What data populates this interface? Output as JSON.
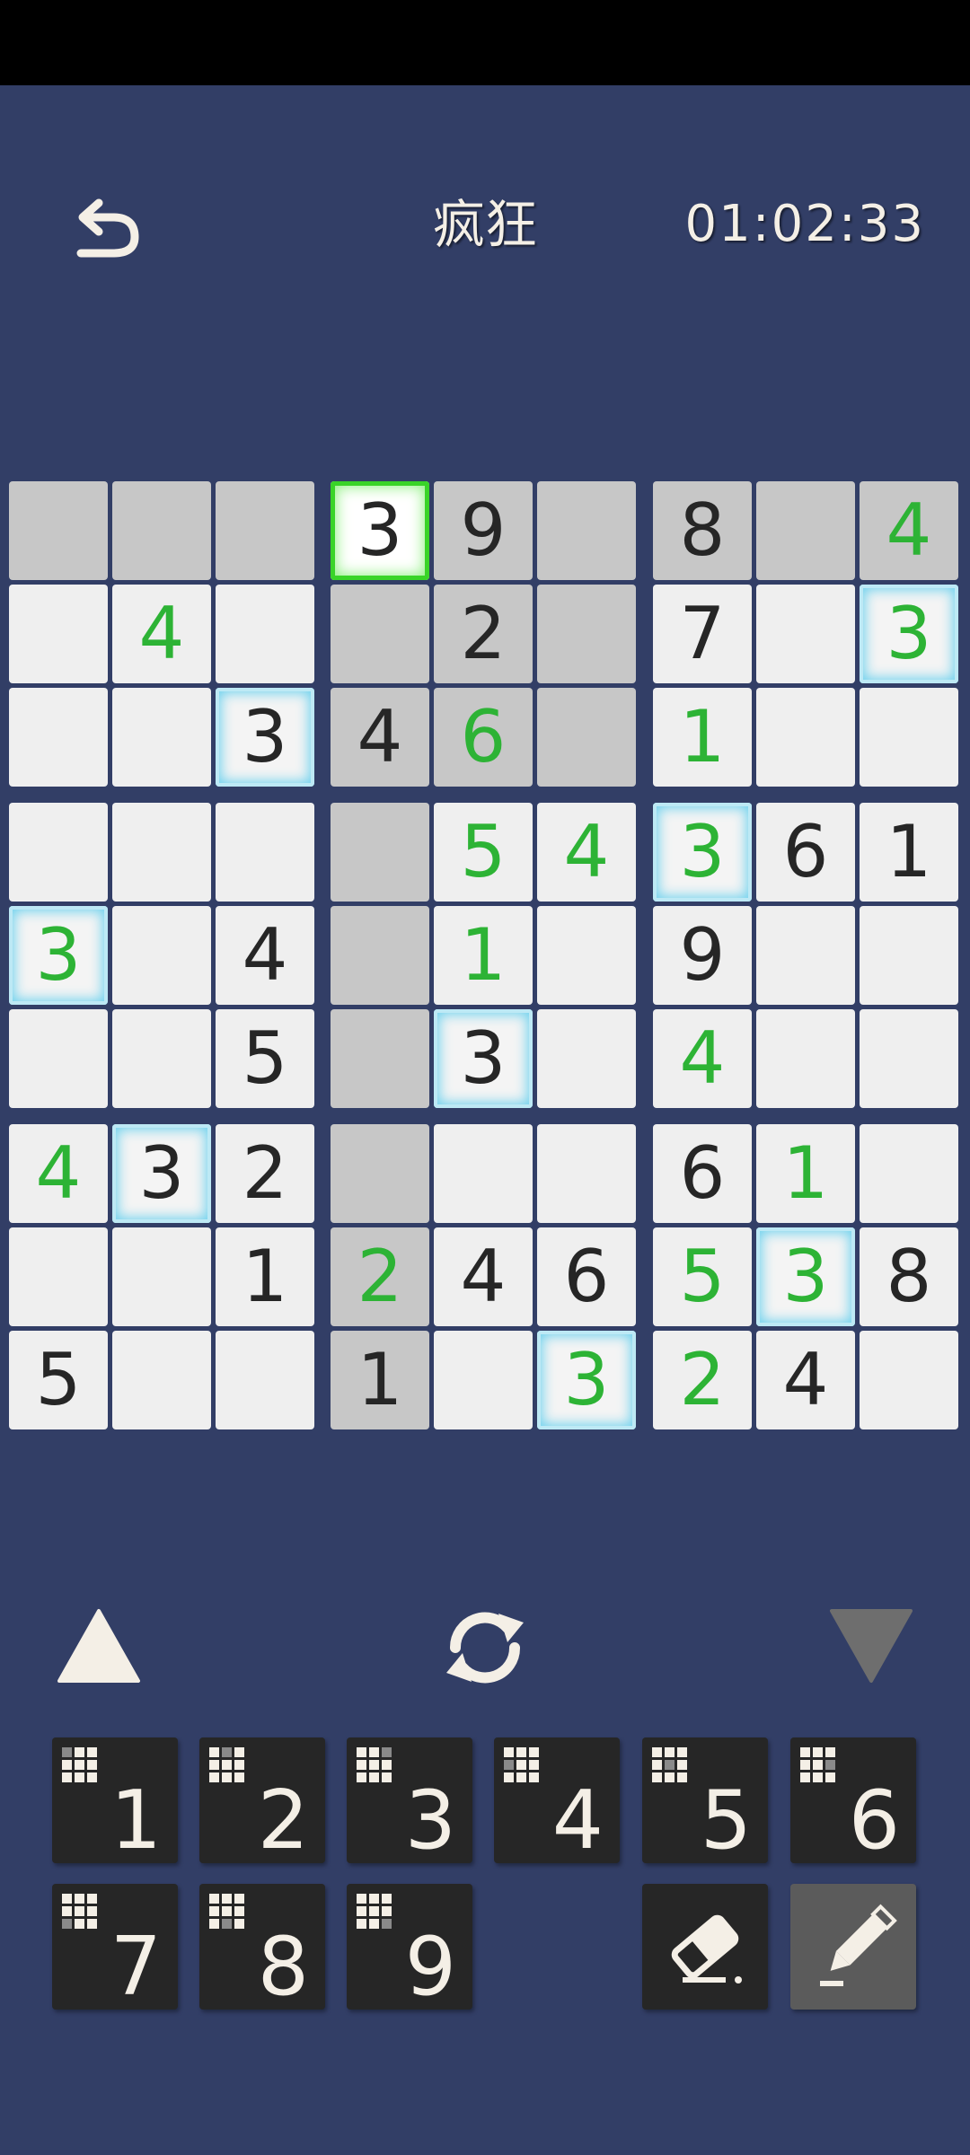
{
  "header": {
    "title": "疯狂",
    "timer": "01:02:33",
    "back_icon": "back-arrow-icon"
  },
  "board": {
    "rows": [
      [
        "",
        "",
        "",
        "3",
        "9",
        "",
        "8",
        "",
        "4"
      ],
      [
        "",
        "4",
        "",
        "",
        "2",
        "",
        "7",
        "",
        "3"
      ],
      [
        "",
        "",
        "3",
        "4",
        "6",
        "",
        "1",
        "",
        ""
      ],
      [
        "",
        "",
        "",
        "",
        "5",
        "4",
        "3",
        "6",
        "1"
      ],
      [
        "3",
        "",
        "4",
        "",
        "1",
        "",
        "9",
        "",
        ""
      ],
      [
        "",
        "",
        "5",
        "",
        "3",
        "",
        "4",
        "",
        ""
      ],
      [
        "4",
        "3",
        "2",
        "",
        "",
        "",
        "6",
        "1",
        ""
      ],
      [
        "",
        "",
        "1",
        "2",
        "4",
        "6",
        "5",
        "3",
        "8"
      ],
      [
        "5",
        "",
        "",
        "1",
        "",
        "3",
        "2",
        "4",
        ""
      ]
    ],
    "green_cells": [
      [
        0,
        8
      ],
      [
        1,
        1
      ],
      [
        1,
        8
      ],
      [
        2,
        4
      ],
      [
        2,
        6
      ],
      [
        3,
        4
      ],
      [
        3,
        5
      ],
      [
        3,
        6
      ],
      [
        4,
        0
      ],
      [
        4,
        4
      ],
      [
        5,
        6
      ],
      [
        6,
        0
      ],
      [
        6,
        7
      ],
      [
        7,
        3
      ],
      [
        7,
        6
      ],
      [
        7,
        7
      ],
      [
        8,
        5
      ],
      [
        8,
        6
      ]
    ],
    "shaded_cells": [
      [
        0,
        0
      ],
      [
        0,
        1
      ],
      [
        0,
        2
      ],
      [
        0,
        4
      ],
      [
        0,
        5
      ],
      [
        0,
        6
      ],
      [
        0,
        7
      ],
      [
        0,
        8
      ],
      [
        1,
        3
      ],
      [
        1,
        4
      ],
      [
        1,
        5
      ],
      [
        2,
        3
      ],
      [
        2,
        4
      ],
      [
        2,
        5
      ],
      [
        3,
        3
      ],
      [
        4,
        3
      ],
      [
        5,
        3
      ],
      [
        6,
        3
      ],
      [
        7,
        3
      ],
      [
        8,
        3
      ]
    ],
    "highlighted_cells": [
      [
        1,
        8
      ],
      [
        2,
        2
      ],
      [
        3,
        6
      ],
      [
        4,
        0
      ],
      [
        5,
        4
      ],
      [
        6,
        1
      ],
      [
        7,
        7
      ],
      [
        8,
        5
      ]
    ],
    "selected_cell": [
      0,
      3
    ],
    "colors": {
      "background": "#323e66",
      "cell": "#efefef",
      "shaded": "#c7c7c7",
      "user_digit": "#2db335",
      "given_digit": "#262626",
      "highlight": "#6fd2ee",
      "selected": "#39d428"
    }
  },
  "controls": {
    "up_icon": "triangle-up-icon",
    "refresh_icon": "refresh-icon",
    "down_icon": "triangle-down-icon"
  },
  "keypad": {
    "digits": [
      "1",
      "2",
      "3",
      "4",
      "5",
      "6",
      "7",
      "8",
      "9"
    ],
    "eraser_icon": "eraser-icon",
    "pencil_icon": "pencil-icon",
    "pencil_mode_active": true
  }
}
